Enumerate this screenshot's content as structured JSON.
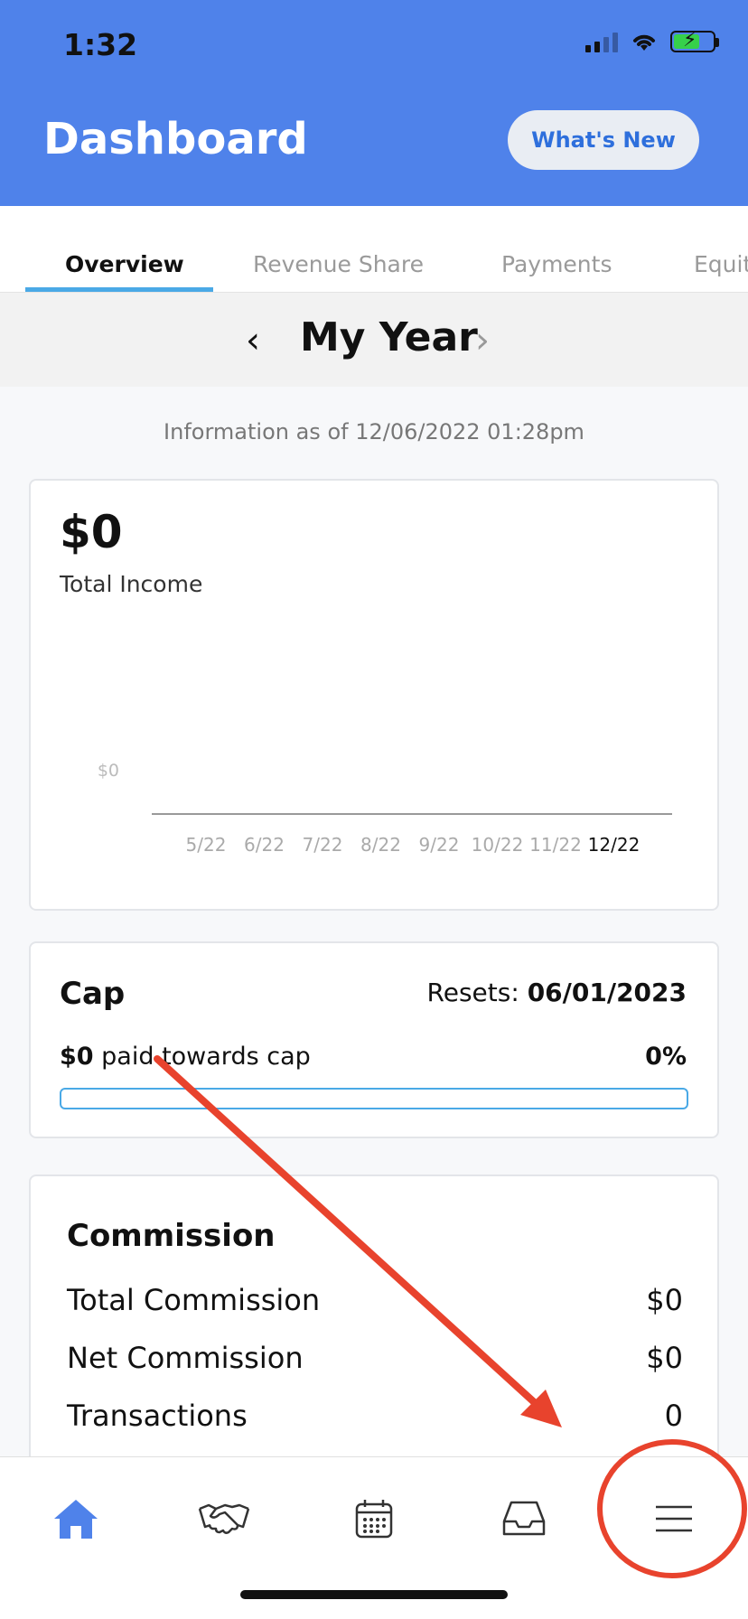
{
  "status_bar": {
    "time": "1:32"
  },
  "header": {
    "title": "Dashboard",
    "whats_new_label": "What's New",
    "bg_color": "#4f82ea"
  },
  "tabs": [
    {
      "label": "Overview",
      "active": true
    },
    {
      "label": "Revenue Share",
      "active": false
    },
    {
      "label": "Payments",
      "active": false
    },
    {
      "label": "Equit",
      "active": false
    }
  ],
  "year_selector": {
    "label": "My Year",
    "prev_icon": "chevron-left-icon",
    "next_icon": "chevron-right-icon"
  },
  "info_line": "Information as of 12/06/2022 01:28pm",
  "income": {
    "value": "$0",
    "label": "Total Income",
    "chart_data": {
      "type": "line",
      "categories": [
        "5/22",
        "6/22",
        "7/22",
        "8/22",
        "9/22",
        "10/22",
        "11/22",
        "12/22"
      ],
      "values": [
        0,
        0,
        0,
        0,
        0,
        0,
        0,
        0
      ],
      "y_tick_label": "$0",
      "highlight_category": "12/22"
    }
  },
  "cap": {
    "title": "Cap",
    "resets_label": "Resets:",
    "resets_date": "06/01/2023",
    "paid_amount": "$0",
    "paid_text": "paid towards cap",
    "percent": "0%",
    "progress_fraction": 0,
    "accent_color": "#4aa9e6"
  },
  "commission": {
    "title": "Commission",
    "rows": [
      {
        "label": "Total Commission",
        "value": "$0"
      },
      {
        "label": "Net Commission",
        "value": "$0"
      },
      {
        "label": "Transactions",
        "value": "0"
      }
    ]
  },
  "bottom_nav": [
    {
      "icon": "home-icon",
      "active": true
    },
    {
      "icon": "handshake-icon",
      "active": false
    },
    {
      "icon": "calendar-icon",
      "active": false
    },
    {
      "icon": "inbox-icon",
      "active": false
    },
    {
      "icon": "menu-icon",
      "active": false
    }
  ],
  "annotation_color": "#e8432d"
}
